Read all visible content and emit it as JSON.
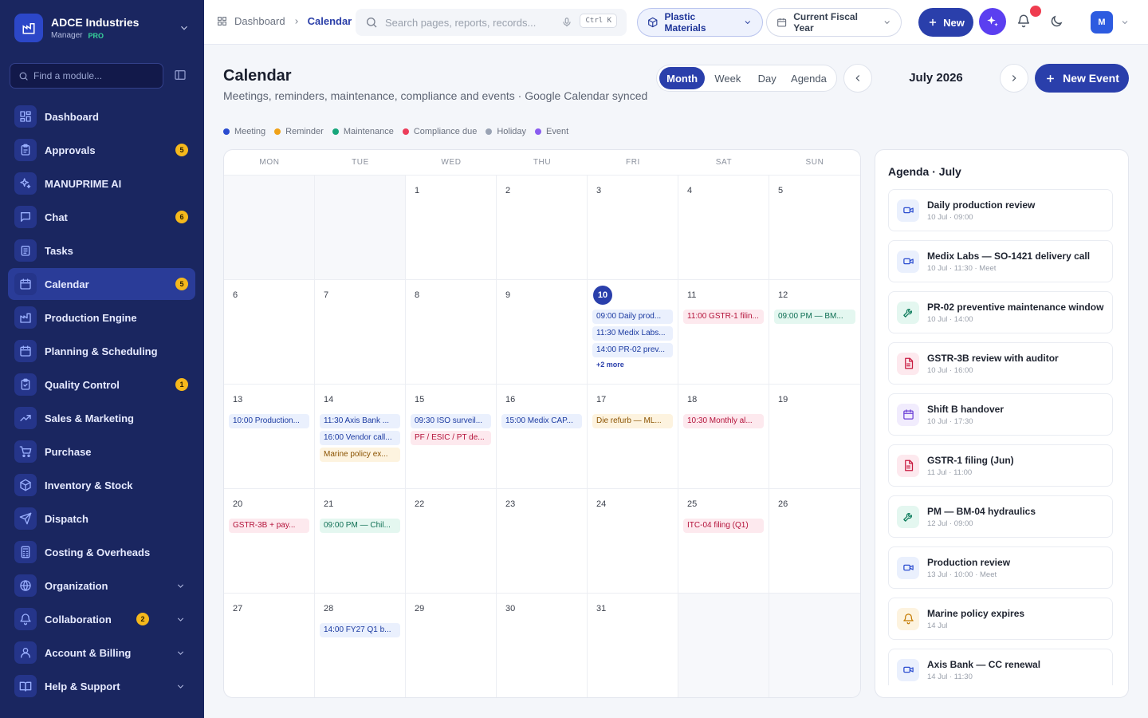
{
  "brand": {
    "name": "ADCE Industries",
    "role": "Manager",
    "tier": "PRO"
  },
  "finder": {
    "placeholder": "Find a module..."
  },
  "nav": [
    {
      "label": "Dashboard",
      "icon": "dashboard-icon"
    },
    {
      "label": "Approvals",
      "icon": "clipboard-icon",
      "badge": "5"
    },
    {
      "label": "MANUPRIME AI",
      "icon": "sparkle-icon"
    },
    {
      "label": "Chat",
      "icon": "chat-icon",
      "badge": "6"
    },
    {
      "label": "Tasks",
      "icon": "tasks-icon"
    },
    {
      "label": "Calendar",
      "icon": "calendar-icon",
      "badge": "5",
      "active": true
    },
    {
      "label": "Production Engine",
      "icon": "factory-icon"
    },
    {
      "label": "Planning & Scheduling",
      "icon": "calendar-icon"
    },
    {
      "label": "Quality Control",
      "icon": "clipboard-check-icon",
      "badge": "1"
    },
    {
      "label": "Sales & Marketing",
      "icon": "trend-icon"
    },
    {
      "label": "Purchase",
      "icon": "cart-icon"
    },
    {
      "label": "Inventory & Stock",
      "icon": "box-icon"
    },
    {
      "label": "Dispatch",
      "icon": "send-icon"
    },
    {
      "label": "Costing & Overheads",
      "icon": "calculator-icon"
    },
    {
      "label": "Organization",
      "icon": "globe-icon",
      "chevron": true
    },
    {
      "label": "Collaboration",
      "icon": "bell-icon",
      "badge": "2",
      "chevron": true
    },
    {
      "label": "Account & Billing",
      "icon": "user-icon",
      "chevron": true
    },
    {
      "label": "Help & Support",
      "icon": "book-icon",
      "chevron": true
    }
  ],
  "topbar": {
    "breadcrumb": [
      "Dashboard",
      "Calendar"
    ],
    "search_placeholder": "Search pages, reports, records...",
    "shortcut": "Ctrl K",
    "material": "Plastic Materials",
    "period": "Current Fiscal Year",
    "new_label": "New",
    "avatar": "M"
  },
  "page": {
    "title": "Calendar",
    "subtitle": "Meetings, reminders, maintenance, compliance and events · Google Calendar synced",
    "views": [
      "Month",
      "Week",
      "Day",
      "Agenda"
    ],
    "active_view": "Month",
    "month_label": "July 2026",
    "new_event": "New Event"
  },
  "legend": [
    {
      "label": "Meeting",
      "color": "#2a4cd0"
    },
    {
      "label": "Reminder",
      "color": "#f0a218"
    },
    {
      "label": "Maintenance",
      "color": "#17a67b"
    },
    {
      "label": "Compliance due",
      "color": "#ec3d5a"
    },
    {
      "label": "Holiday",
      "color": "#9aa3b4"
    },
    {
      "label": "Event",
      "color": "#8a5cf0"
    }
  ],
  "calendar": {
    "weekdays": [
      "MON",
      "TUE",
      "WED",
      "THU",
      "FRI",
      "SAT",
      "SUN"
    ],
    "cells": [
      {
        "day": ""
      },
      {
        "day": ""
      },
      {
        "day": "1"
      },
      {
        "day": "2"
      },
      {
        "day": "3"
      },
      {
        "day": "4"
      },
      {
        "day": "5"
      },
      {
        "day": "6"
      },
      {
        "day": "7"
      },
      {
        "day": "8"
      },
      {
        "day": "9"
      },
      {
        "day": "10",
        "today": true,
        "more": "+2 more",
        "events": [
          {
            "text": "09:00 Daily prod...",
            "type": "meeting"
          },
          {
            "text": "11:30 Medix Labs...",
            "type": "meeting"
          },
          {
            "text": "14:00 PR-02 prev...",
            "type": "meeting"
          }
        ]
      },
      {
        "day": "11",
        "events": [
          {
            "text": "11:00 GSTR-1 filin...",
            "type": "compliance"
          }
        ]
      },
      {
        "day": "12",
        "events": [
          {
            "text": "09:00 PM — BM...",
            "type": "maintenance"
          }
        ]
      },
      {
        "day": "13",
        "events": [
          {
            "text": "10:00 Production...",
            "type": "meeting"
          }
        ]
      },
      {
        "day": "14",
        "events": [
          {
            "text": "11:30 Axis Bank ...",
            "type": "meeting"
          },
          {
            "text": "16:00 Vendor call...",
            "type": "meeting"
          },
          {
            "text": "Marine policy ex...",
            "type": "reminder"
          }
        ]
      },
      {
        "day": "15",
        "events": [
          {
            "text": "09:30 ISO surveil...",
            "type": "meeting"
          },
          {
            "text": "PF / ESIC / PT de...",
            "type": "compliance"
          }
        ]
      },
      {
        "day": "16",
        "events": [
          {
            "text": "15:00 Medix CAP...",
            "type": "meeting"
          }
        ]
      },
      {
        "day": "17",
        "events": [
          {
            "text": "Die refurb — ML...",
            "type": "reminder"
          }
        ]
      },
      {
        "day": "18",
        "events": [
          {
            "text": "10:30 Monthly al...",
            "type": "compliance"
          }
        ]
      },
      {
        "day": "19"
      },
      {
        "day": "20",
        "events": [
          {
            "text": "GSTR-3B + pay...",
            "type": "compliance"
          }
        ]
      },
      {
        "day": "21",
        "events": [
          {
            "text": "09:00 PM — Chil...",
            "type": "maintenance"
          }
        ]
      },
      {
        "day": "22"
      },
      {
        "day": "23"
      },
      {
        "day": "24"
      },
      {
        "day": "25",
        "events": [
          {
            "text": "ITC-04 filing (Q1)",
            "type": "compliance"
          }
        ]
      },
      {
        "day": "26"
      },
      {
        "day": "27"
      },
      {
        "day": "28",
        "events": [
          {
            "text": "14:00 FY27 Q1 b...",
            "type": "meeting"
          }
        ]
      },
      {
        "day": "29"
      },
      {
        "day": "30"
      },
      {
        "day": "31"
      },
      {
        "day": ""
      },
      {
        "day": ""
      }
    ]
  },
  "agenda": {
    "title": "Agenda · July",
    "items": [
      {
        "name": "Daily production review",
        "time": "10 Jul · 09:00",
        "type": "meeting"
      },
      {
        "name": "Medix Labs — SO-1421 delivery call",
        "time": "10 Jul · 11:30 · Meet",
        "type": "meeting"
      },
      {
        "name": "PR-02 preventive maintenance window",
        "time": "10 Jul · 14:00",
        "type": "maintenance"
      },
      {
        "name": "GSTR-3B review with auditor",
        "time": "10 Jul · 16:00",
        "type": "compliance"
      },
      {
        "name": "Shift B handover",
        "time": "10 Jul · 17:30",
        "type": "event"
      },
      {
        "name": "GSTR-1 filing (Jun)",
        "time": "11 Jul · 11:00",
        "type": "compliance"
      },
      {
        "name": "PM — BM-04 hydraulics",
        "time": "12 Jul · 09:00",
        "type": "maintenance"
      },
      {
        "name": "Production review",
        "time": "13 Jul · 10:00 · Meet",
        "type": "meeting"
      },
      {
        "name": "Marine policy expires",
        "time": "14 Jul",
        "type": "reminder"
      },
      {
        "name": "Axis Bank — CC renewal",
        "time": "14 Jul · 11:30",
        "type": "meeting"
      }
    ]
  }
}
